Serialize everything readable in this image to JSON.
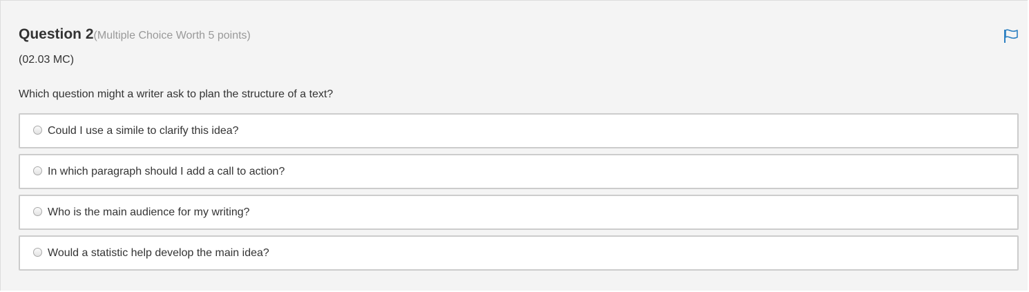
{
  "question": {
    "title": "Question 2",
    "worth": "(Multiple Choice Worth 5 points)",
    "code": "(02.03 MC)",
    "prompt": "Which question might a writer ask to plan the structure of a text?",
    "flag_icon": "flag-icon"
  },
  "choices": [
    {
      "label": "Could I use a simile to clarify this idea?",
      "selected": false
    },
    {
      "label": "In which paragraph should I add a call to action?",
      "selected": false
    },
    {
      "label": "Who is the main audience for my writing?",
      "selected": false
    },
    {
      "label": "Would a statistic help develop the main idea?",
      "selected": false
    }
  ],
  "colors": {
    "panel_background": "#f4f4f4",
    "choice_border": "#cccccc",
    "flag_accent": "#2a7fc1",
    "muted_text": "#999999"
  }
}
